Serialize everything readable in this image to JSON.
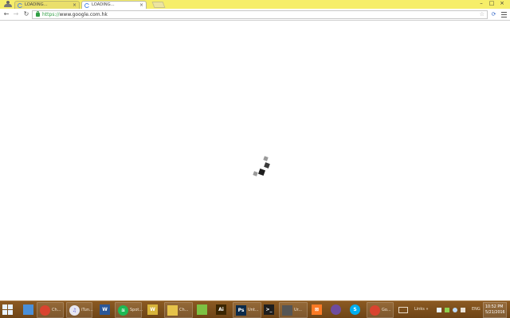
{
  "browser": {
    "tabs": [
      {
        "title": "LOADING...",
        "active": false
      },
      {
        "title": "LOADING...",
        "active": true
      }
    ],
    "tab_close_glyph": "×",
    "url_scheme": "https://",
    "url_rest": "www.google.com.hk",
    "window_controls": {
      "minimize": "–",
      "maximize": "□",
      "close": "×"
    },
    "nav": {
      "back": "←",
      "forward": "→",
      "reload": "↻"
    },
    "star_glyph": "☆",
    "ext_glyph": "⟳",
    "loading_indicator": {
      "state": "loading",
      "icon": "spinner-squares-icon"
    }
  },
  "taskbar": {
    "items": [
      {
        "name": "taskbar-item-network",
        "icon": "network-icon",
        "label": "",
        "color": "#4a8fd8",
        "glyph": ""
      },
      {
        "name": "taskbar-item-chrome-1",
        "icon": "chrome-icon",
        "label": "Ch...",
        "color": "#d9432f",
        "glyph": ""
      },
      {
        "name": "taskbar-item-itunes",
        "icon": "itunes-icon",
        "label": "iTun...",
        "color": "#e6e6f0",
        "glyph": "♫"
      },
      {
        "name": "taskbar-item-word",
        "icon": "word-icon",
        "label": "",
        "color": "#2b5797",
        "glyph": "W"
      },
      {
        "name": "taskbar-item-spotify",
        "icon": "spotify-icon",
        "label": "Spot...",
        "color": "#1db954",
        "glyph": "≋"
      },
      {
        "name": "taskbar-item-w-app",
        "icon": "w-app-icon",
        "label": "",
        "color": "#d8b43a",
        "glyph": "W"
      },
      {
        "name": "taskbar-item-folder",
        "icon": "folder-icon",
        "label": "Ch...",
        "color": "#e6c34a",
        "glyph": ""
      },
      {
        "name": "taskbar-item-green-app",
        "icon": "green-app-icon",
        "label": "",
        "color": "#7cc142",
        "glyph": ""
      },
      {
        "name": "taskbar-item-illustrator",
        "icon": "illustrator-icon",
        "label": "",
        "color": "#3a2500",
        "glyph": "Ai"
      },
      {
        "name": "taskbar-item-photoshop",
        "icon": "photoshop-icon",
        "label": "Unt...",
        "color": "#0b2a4a",
        "glyph": "Ps"
      },
      {
        "name": "taskbar-item-terminal",
        "icon": "terminal-icon",
        "label": "",
        "color": "#1e1e1e",
        "glyph": ">_"
      },
      {
        "name": "taskbar-item-app-gray",
        "icon": "app-window-icon",
        "label": "Ur...",
        "color": "#555555",
        "glyph": ""
      },
      {
        "name": "taskbar-item-xampp",
        "icon": "xampp-icon",
        "label": "",
        "color": "#fb7a24",
        "glyph": "⊠"
      },
      {
        "name": "taskbar-item-github",
        "icon": "github-icon",
        "label": "",
        "color": "#6e4c9e",
        "glyph": ""
      },
      {
        "name": "taskbar-item-skype",
        "icon": "skype-icon",
        "label": "",
        "color": "#00aff0",
        "glyph": "S"
      },
      {
        "name": "taskbar-item-chrome-2",
        "icon": "chrome-icon",
        "label": "Go...",
        "color": "#d9432f",
        "glyph": ""
      }
    ],
    "tray": {
      "links": "Links",
      "arrow": "»",
      "lang": "ENG"
    },
    "clock": {
      "time": "10:52 PM",
      "date": "5/21/2016"
    }
  }
}
